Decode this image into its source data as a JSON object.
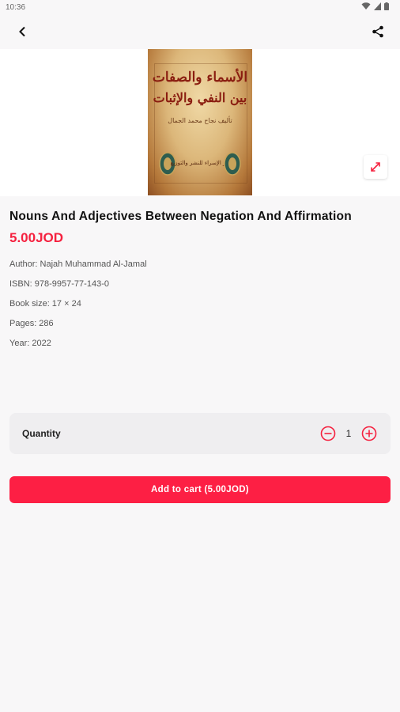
{
  "status_bar": {
    "time": "10:36"
  },
  "product": {
    "cover_title_line1": "الأسماء والصفات",
    "cover_title_line2": "بين النفي والإثبات",
    "cover_subtitle": "تأليف نجاح محمد الجمال",
    "cover_footer": "دار الإسراء للنشر والتوزيع",
    "title": "Nouns And Adjectives Between Negation And Affirmation",
    "price": "5.00JOD",
    "author": "Author: Najah Muhammad Al-Jamal",
    "isbn": "ISBN: 978-9957-77-143-0",
    "book_size": "Book size: 17 × 24",
    "pages": "Pages: 286",
    "year": "Year: 2022"
  },
  "quantity": {
    "label": "Quantity",
    "value": "1"
  },
  "cart_button": {
    "label": "Add to cart (5.00JOD)"
  },
  "colors": {
    "accent": "#fd1f44",
    "price": "#f5213f"
  },
  "icons": [
    "back-arrow-icon",
    "share-icon",
    "fullscreen-icon",
    "minus-circle-icon",
    "plus-circle-icon",
    "wifi-icon",
    "signal-icon",
    "battery-icon"
  ]
}
